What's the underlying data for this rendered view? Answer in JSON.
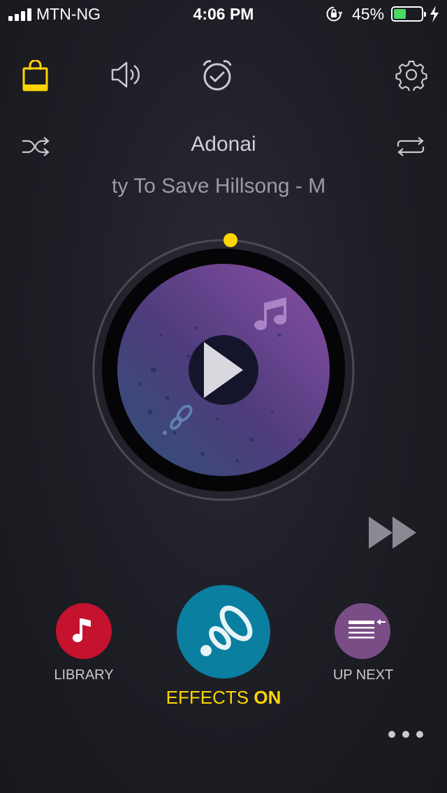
{
  "status_bar": {
    "carrier": "MTN-NG",
    "time": "4:06 PM",
    "battery_percent": "45%",
    "battery_level": 0.45,
    "signal_bars": 4,
    "icons": [
      "signal-icon",
      "orientation-lock-icon",
      "battery-icon",
      "charging-bolt-icon"
    ]
  },
  "toolbar": {
    "icons": [
      "shopping-bag-icon",
      "volume-icon",
      "alarm-clock-icon",
      "settings-gear-icon"
    ],
    "accent_color": "#ffd400"
  },
  "player": {
    "title": "Adonai",
    "scrolling_text": "ty To Save   Hillsong - M",
    "progress": 0.0,
    "state": "paused",
    "controls": [
      "shuffle-icon",
      "repeat-icon",
      "play-icon",
      "fast-forward-icon"
    ]
  },
  "bottom_nav": {
    "library_label": "LIBRARY",
    "up_next_label": "UP NEXT",
    "effects_label": "EFFECTS",
    "effects_state": "ON",
    "colors": {
      "library": "#c4122f",
      "up_next": "#7a4d87",
      "effects": "#0a7fa0"
    }
  }
}
